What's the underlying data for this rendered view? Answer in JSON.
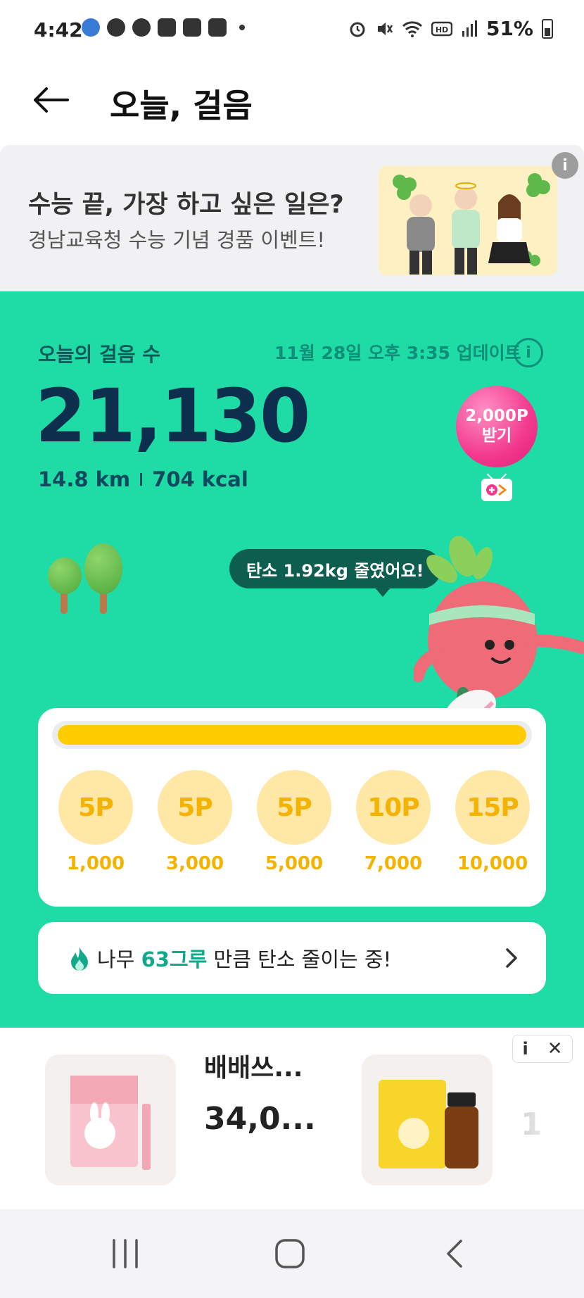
{
  "status_bar": {
    "time": "4:42",
    "battery": "51%",
    "icons": [
      "face-icon",
      "person-icon",
      "face-icon",
      "cash-icon",
      "stack-icon",
      "image-icon",
      "alarm-icon",
      "mute-icon",
      "wifi-icon",
      "hd-icon",
      "signal-icon",
      "battery-icon"
    ]
  },
  "header": {
    "title": "오늘, 걸음"
  },
  "banner": {
    "title": "수능 끝, 가장 하고 싶은 일은?",
    "subtitle": "경남교육청 수능 기념 경품 이벤트!",
    "info": "i"
  },
  "steps": {
    "label": "오늘의 걸음 수",
    "updated": "11월 28일 오후 3:35 업데이트",
    "info": "i",
    "count": "21,130",
    "distance": "14.8 km",
    "calories": "704 kcal"
  },
  "balloon": {
    "points": "2,000P",
    "action": "받기"
  },
  "speech": {
    "text": "탄소 1.92kg 줄였어요!"
  },
  "progress": {
    "fraction": 1.0,
    "milestones": [
      {
        "points": "5P",
        "steps": "1,000"
      },
      {
        "points": "5P",
        "steps": "3,000"
      },
      {
        "points": "5P",
        "steps": "5,000"
      },
      {
        "points": "10P",
        "steps": "7,000"
      },
      {
        "points": "15P",
        "steps": "10,000"
      }
    ]
  },
  "trees": {
    "prefix": "나무 ",
    "count": "63그루",
    "suffix": " 만큼 탄소 줄이는 중!"
  },
  "ad": {
    "brand": "배배쓰...",
    "price": "34,0...",
    "next_partial": "1",
    "info": "i",
    "close": "✕"
  },
  "colors": {
    "main_green": "#1fdba6",
    "steps_navy": "#0d2e4d",
    "progress_yellow": "#ffcc00",
    "milestone_circle": "#ffe7a6",
    "highlight_teal": "#12a88a",
    "balloon_pink": "#f2388d"
  }
}
